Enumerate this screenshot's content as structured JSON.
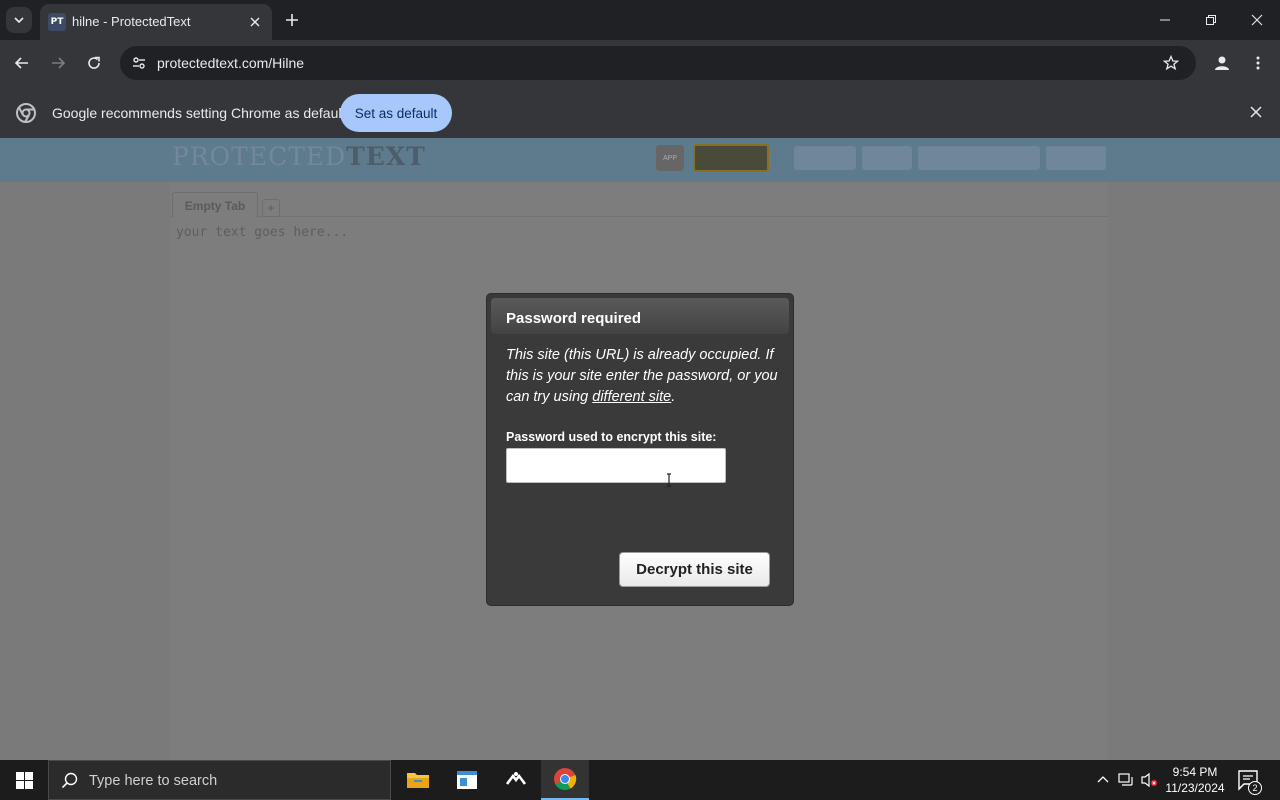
{
  "browser": {
    "tab_favicon": "PT",
    "tab_title": "hilne - ProtectedText",
    "url": "protectedtext.com/Hilne"
  },
  "infobar": {
    "message": "Google recommends setting Chrome as default",
    "button_label": "Set as default"
  },
  "site": {
    "logo_light": "PROTECTED",
    "logo_bold": "TEXT",
    "tab_label": "Empty Tab",
    "add_tab": "+",
    "editor_placeholder": "your text goes here..."
  },
  "modal": {
    "title": "Password required",
    "message_before": "This site (this URL) is already occupied. If this is your site enter the password, or you can try using ",
    "message_link": "different site",
    "message_after": ".",
    "password_label": "Password used to encrypt this site:",
    "password_value": "",
    "decrypt_label": "Decrypt this site"
  },
  "taskbar": {
    "search_placeholder": "Type here to search",
    "time": "9:54 PM",
    "date": "11/23/2024",
    "notification_count": "2"
  },
  "colors": {
    "chrome_dark": "#202124",
    "chrome_toolbar": "#35363a",
    "accent_button": "#a8c7fa",
    "modal_bg": "#3a3a3a",
    "dim_overlay": "#7a7a7a",
    "taskbar_bg": "#1c1c1c"
  }
}
